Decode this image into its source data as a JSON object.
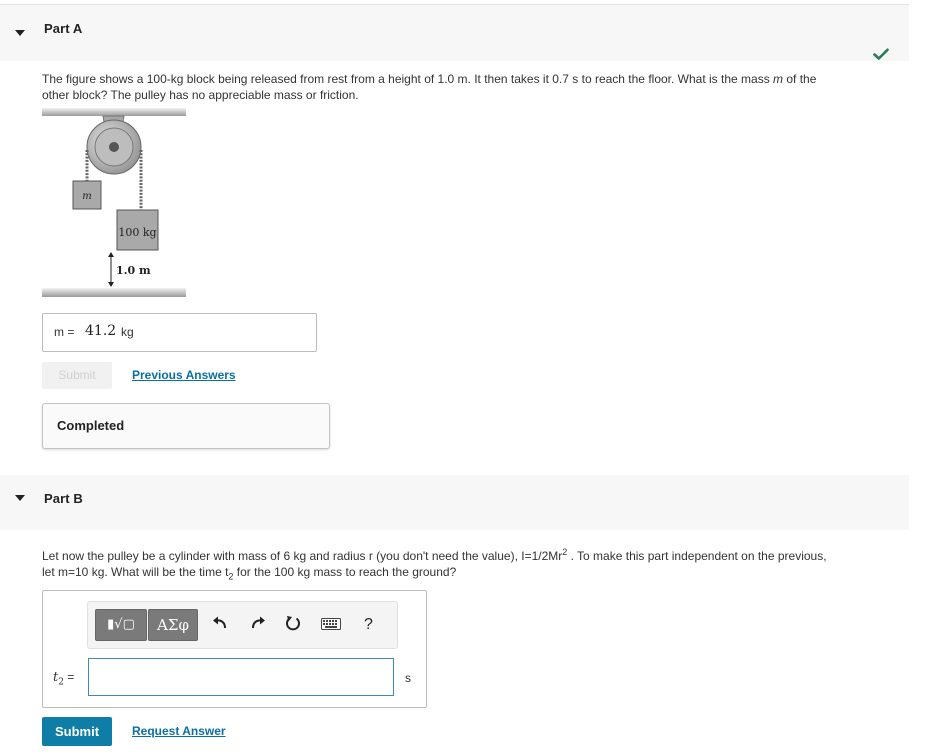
{
  "partA": {
    "title": "Part A",
    "question_line1": "The figure shows a 100-kg block being released from rest from a height of 1.0 m. It then takes it 0.7 s to reach the floor. What is the mass ",
    "question_var": "m",
    "question_line1_end": " of the",
    "question_line2": "other block? The pulley has no appreciable mass or friction.",
    "figure": {
      "label_m": "m",
      "label_block": "100 kg",
      "label_height": "1.0 m"
    },
    "answer_label": "m =",
    "answer_value": "41.2",
    "answer_unit": "kg",
    "submit_label": "Submit",
    "previous_answers_label": "Previous Answers",
    "completed_label": "Completed"
  },
  "partB": {
    "title": "Part B",
    "q_line1_a": "Let now the pulley be a cylinder with mass of  6 kg and radius r (you don't need the value), I=1/2Mr",
    "q_line1_sup": "2",
    "q_line1_b": " . To make this part independent on the previous,",
    "q_line2_a": "let m=10 kg. What will be the time t",
    "q_line2_sub": "2",
    "q_line2_b": " for the 100 kg mass to reach the ground?",
    "toolbar": {
      "templates_label": "▮√▢",
      "greek_label": "ΑΣφ",
      "help_label": "?"
    },
    "input_label_var": "t",
    "input_label_sub": "2",
    "input_label_eq": " =",
    "input_value": "",
    "unit": "s",
    "submit_label": "Submit",
    "request_answer_label": "Request Answer"
  },
  "colors": {
    "accent": "#0f7ea6",
    "check": "#2b7a59",
    "link": "#0b6fa4"
  }
}
